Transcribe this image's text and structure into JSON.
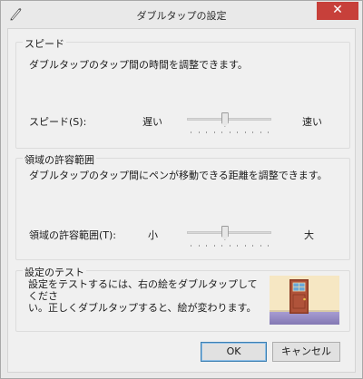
{
  "window": {
    "title": "ダブルタップの設定",
    "icon": "pen-icon",
    "close_glyph": "✕"
  },
  "speed": {
    "group_title": "スピード",
    "description": "ダブルタップのタップ間の時間を調整できます。",
    "label": "スピード(S):",
    "low_label": "遅い",
    "high_label": "速い",
    "slider_value": 0.45
  },
  "area": {
    "group_title": "領域の許容範囲",
    "description": "ダブルタップのタップ間にペンが移動できる距離を調整できます。",
    "label": "領域の許容範囲(T):",
    "low_label": "小",
    "high_label": "大",
    "slider_value": 0.45
  },
  "test": {
    "group_title": "設定のテスト",
    "description": "設定をテストするには、右の絵をダブルタップしてくださ\nい。正しくダブルタップすると、絵が変わります。",
    "picture_icon": "door-icon"
  },
  "buttons": {
    "ok_label": "OK",
    "cancel_label": "キャンセル"
  },
  "colors": {
    "close_button": "#c7403a",
    "ok_border": "#3c7fb1"
  }
}
